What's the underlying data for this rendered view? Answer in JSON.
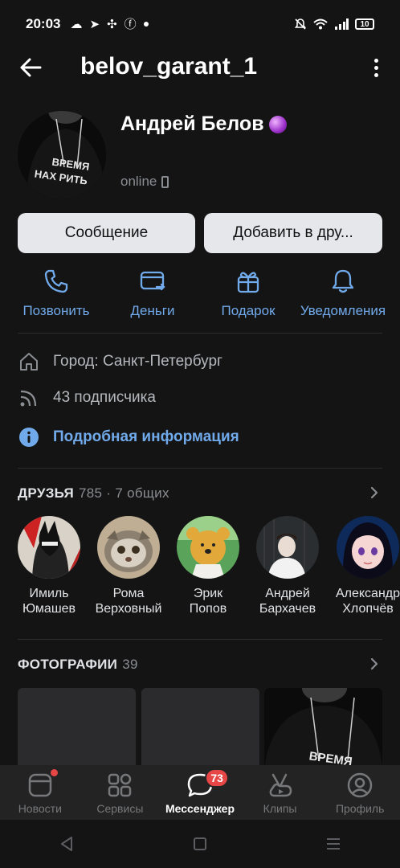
{
  "status_bar": {
    "time": "20:03",
    "battery": "10"
  },
  "header": {
    "title": "belov_garant_1"
  },
  "profile": {
    "name": "Андрей Белов",
    "status": "online",
    "avatar_shirt_line1": "ВРЕМЯ",
    "avatar_shirt_line2": "НАХ РИТЬ"
  },
  "buttons": {
    "message": "Сообщение",
    "add_friend": "Добавить в дру..."
  },
  "actions": [
    {
      "label": "Позвонить",
      "icon": "phone-icon"
    },
    {
      "label": "Деньги",
      "icon": "money-card-icon"
    },
    {
      "label": "Подарок",
      "icon": "gift-icon"
    },
    {
      "label": "Уведомления",
      "icon": "bell-icon"
    }
  ],
  "info": {
    "city": "Город: Санкт-Петербург",
    "followers": "43 подписчика",
    "more": "Подробная информация"
  },
  "friends": {
    "title": "ДРУЗЬЯ",
    "count": "785 · 7 общих",
    "items": [
      {
        "first": "Имиль",
        "last": "Юмашев"
      },
      {
        "first": "Рома",
        "last": "Верховный"
      },
      {
        "first": "Эрик",
        "last": "Попов"
      },
      {
        "first": "Андрей",
        "last": "Бархачев"
      },
      {
        "first": "Александр",
        "last": "Хлопчёв"
      }
    ]
  },
  "photos": {
    "title": "ФОТОГРАФИИ",
    "count": "39",
    "shirt_text": "ВРЕМЯ"
  },
  "tabbar": {
    "items": [
      {
        "label": "Новости",
        "icon": "news-icon"
      },
      {
        "label": "Сервисы",
        "icon": "services-icon"
      },
      {
        "label": "Мессенджер",
        "icon": "messenger-icon",
        "badge": "73"
      },
      {
        "label": "Клипы",
        "icon": "clips-icon"
      },
      {
        "label": "Профиль",
        "icon": "profile-icon"
      }
    ]
  },
  "colors": {
    "accent": "#71aaeb",
    "background": "#141414",
    "badge": "#e64646"
  }
}
